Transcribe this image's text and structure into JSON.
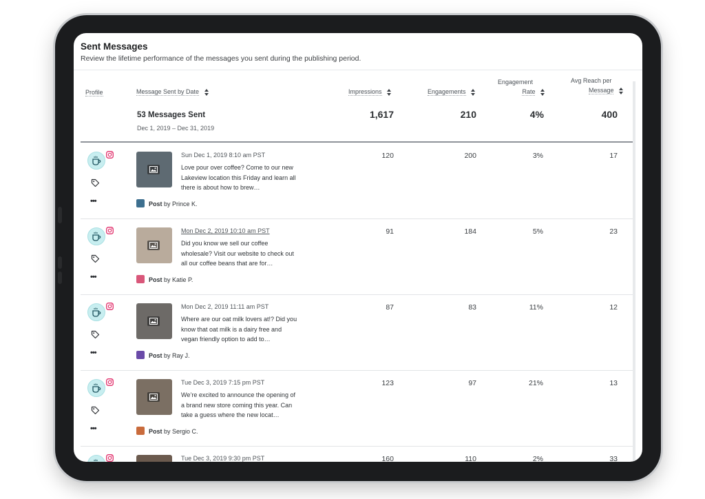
{
  "header": {
    "title": "Sent Messages",
    "subtitle": "Review the lifetime performance of the messages you sent during the publishing period."
  },
  "columns": {
    "profile": "Profile",
    "sent_by_date": "Message Sent by Date",
    "impressions": "Impressions",
    "engagements": "Engagements",
    "engagement_rate_line1": "Engagement",
    "engagement_rate_line2": "Rate",
    "avg_reach_line1": "Avg Reach per",
    "avg_reach_line2": "Message"
  },
  "summary": {
    "messages_sent": "53 Messages Sent",
    "date_range": "Dec 1, 2019 – Dec 31, 2019",
    "impressions": "1,617",
    "engagements": "210",
    "engagement_rate": "4%",
    "avg_reach": "400"
  },
  "colors": {
    "instagram": "#e1306c",
    "profile_avatar_bg": "#c8eef0",
    "divider": "#8e9399"
  },
  "icons": {
    "profile": "coffee-cup-icon",
    "network": "instagram-icon",
    "tag": "tag-icon",
    "more": "more-icon",
    "image_type": "image-icon",
    "sort": "sort-icon"
  },
  "rows": [
    {
      "date": "Sun Dec 1, 2019 8:10 am PST",
      "text": "Love pour over coffee? Come to our new Lakeview location this Friday and learn all there is about how to brew…",
      "post_label": "Post",
      "by": "by Prince K.",
      "impressions": "120",
      "engagements": "200",
      "engagement_rate": "3%",
      "avg_reach": "17",
      "thumb_color": "#5e6a72",
      "avatar_color": "#3d6f8f"
    },
    {
      "date": "Mon Dec 2, 2019 10:10 am PST",
      "text": "Did you know we sell our coffee wholesale? Visit our website to check out all our coffee beans that are for…",
      "post_label": "Post",
      "by": "by Katie P.",
      "impressions": "91",
      "engagements": "184",
      "engagement_rate": "5%",
      "avg_reach": "23",
      "thumb_color": "#b9ab9c",
      "avatar_color": "#d9577a"
    },
    {
      "date": "Mon Dec 2, 2019 11:11 am PST",
      "text": "Where are our oat milk lovers at!? Did you know that oat milk is a dairy free and vegan friendly option to add to…",
      "post_label": "Post",
      "by": "by Ray J.",
      "impressions": "87",
      "engagements": "83",
      "engagement_rate": "11%",
      "avg_reach": "12",
      "thumb_color": "#6d6a67",
      "avatar_color": "#6a4aa8"
    },
    {
      "date": "Tue Dec 3, 2019 7:15 pm PST",
      "text": "We’re excited to announce the opening of a brand new store coming this year. Can take a guess where the new locat…",
      "post_label": "Post",
      "by": "by Sergio C.",
      "impressions": "123",
      "engagements": "97",
      "engagement_rate": "21%",
      "avg_reach": "13",
      "thumb_color": "#7b6f63",
      "avatar_color": "#c96b3c"
    },
    {
      "date": "Tue Dec 3, 2019 9:30 pm PST",
      "text": "",
      "post_label": "",
      "by": "",
      "impressions": "160",
      "engagements": "110",
      "engagement_rate": "2%",
      "avg_reach": "33",
      "thumb_color": "#6b5a4e",
      "avatar_color": "#888888"
    }
  ]
}
